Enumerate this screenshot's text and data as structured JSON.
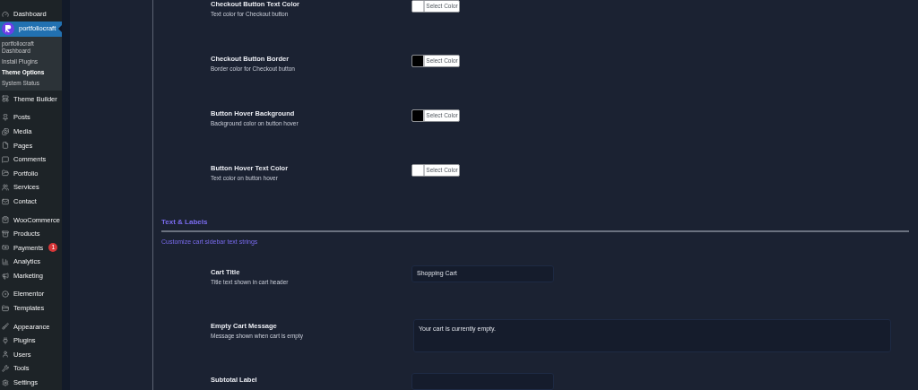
{
  "sidebar": {
    "groups": [
      [
        {
          "label": "Dashboard",
          "selected": false
        },
        {
          "label": "portfoliocraft",
          "selected": true,
          "submenu": [
            {
              "label": "portfoliocraft Dashboard",
              "selected": false
            },
            {
              "label": "Install Plugins",
              "selected": false
            },
            {
              "label": "Theme Options",
              "selected": true
            },
            {
              "label": "System Status",
              "selected": false
            }
          ]
        },
        {
          "label": "Theme Builder",
          "selected": false
        }
      ],
      [
        {
          "label": "Posts",
          "selected": false
        },
        {
          "label": "Media",
          "selected": false
        },
        {
          "label": "Pages",
          "selected": false
        },
        {
          "label": "Comments",
          "selected": false
        },
        {
          "label": "Portfolio",
          "selected": false
        },
        {
          "label": "Services",
          "selected": false
        },
        {
          "label": "Contact",
          "selected": false
        }
      ],
      [
        {
          "label": "WooCommerce",
          "selected": false
        },
        {
          "label": "Products",
          "selected": false
        },
        {
          "label": "Payments",
          "selected": false,
          "badge": "1"
        },
        {
          "label": "Analytics",
          "selected": false
        },
        {
          "label": "Marketing",
          "selected": false
        }
      ],
      [
        {
          "label": "Elementor",
          "selected": false
        },
        {
          "label": "Templates",
          "selected": false
        }
      ],
      [
        {
          "label": "Appearance",
          "selected": false
        },
        {
          "label": "Plugins",
          "selected": false
        },
        {
          "label": "Users",
          "selected": false
        },
        {
          "label": "Tools",
          "selected": false
        },
        {
          "label": "Settings",
          "selected": false
        }
      ]
    ]
  },
  "color_settings": [
    {
      "title": "Checkout Button Text Color",
      "description": "Text color for Checkout button",
      "color": "#ffffff",
      "button": "Select Color"
    },
    {
      "title": "Checkout Button Border",
      "description": "Border color for Checkout button",
      "color": "#000000",
      "button": "Select Color"
    },
    {
      "title": "Button Hover Background",
      "description": "Background color on button hover",
      "color": "#000000",
      "button": "Select Color"
    },
    {
      "title": "Button Hover Text Color",
      "description": "Text color on button hover",
      "color": "#ffffff",
      "button": "Select Color"
    }
  ],
  "section": {
    "title": "Text & Labels",
    "subtitle": "Customize cart sidebar text strings"
  },
  "text_settings": [
    {
      "kind": "input",
      "title": "Cart Title",
      "description": "Title text shown in cart header",
      "value": "Shopping Cart"
    },
    {
      "kind": "textarea",
      "title": "Empty Cart Message",
      "description": "Message shown when cart is empty",
      "value": "Your cart is currently empty."
    },
    {
      "kind": "input",
      "title": "Subtotal Label"
    }
  ]
}
